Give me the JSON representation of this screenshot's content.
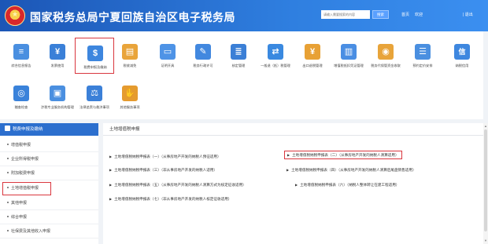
{
  "header": {
    "title": "国家税务总局宁夏回族自治区电子税务局",
    "search_placeholder": "请输入需要搜索的内容",
    "search_button": "搜索",
    "link_home": "首页",
    "link_welcome": "欢迎",
    "link_logout": "| 退出"
  },
  "top_menu": [
    {
      "label": "综合信息报告",
      "icon": "report-icon",
      "color": "#4a8fe0",
      "glyph": "≡"
    },
    {
      "label": "发票使用",
      "icon": "invoice-icon",
      "color": "#3a80d8",
      "glyph": "¥"
    },
    {
      "label": "税费申报及缴纳",
      "icon": "tax-declare-icon",
      "color": "#3d86de",
      "glyph": "$"
    },
    {
      "label": "税收减免",
      "icon": "tax-reduction-icon",
      "color": "#e9a43a",
      "glyph": "▤"
    },
    {
      "label": "证明开具",
      "icon": "certificate-icon",
      "color": "#4e93e6",
      "glyph": "▭"
    },
    {
      "label": "税务行政许可",
      "icon": "permit-icon",
      "color": "#4288df",
      "glyph": "✎"
    },
    {
      "label": "核定管理",
      "icon": "verify-icon",
      "color": "#3b7fd6",
      "glyph": "≣"
    },
    {
      "label": "一般退（抵）税管理",
      "icon": "refund-icon",
      "color": "#3a89e0",
      "glyph": "⇄"
    },
    {
      "label": "出口退税管理",
      "icon": "export-refund-icon",
      "color": "#e8a135",
      "glyph": "¥"
    },
    {
      "label": "增值税抵扣凭证管理",
      "icon": "vat-voucher-icon",
      "color": "#4a8ee3",
      "glyph": "▥"
    },
    {
      "label": "税务代保管资金收取",
      "icon": "custody-fund-icon",
      "color": "#e8a43a",
      "glyph": "◉"
    },
    {
      "label": "预约定价安排",
      "icon": "pricing-icon",
      "color": "#4a8fe0",
      "glyph": "☰"
    },
    {
      "label": "纳税信用",
      "icon": "credit-icon",
      "color": "#3e87df",
      "glyph": "信"
    },
    {
      "label": "稽查检查",
      "icon": "inspection-icon",
      "color": "#3a82da",
      "glyph": "◎"
    },
    {
      "label": "涉税专业服务机构管理",
      "icon": "agency-icon",
      "color": "#4a8fe0",
      "glyph": "▣"
    },
    {
      "label": "法律追责与救济事项",
      "icon": "legal-icon",
      "color": "#3b80d8",
      "glyph": "⚖"
    },
    {
      "label": "其他服务事项",
      "icon": "other-service-icon",
      "color": "#e59b2f",
      "glyph": "✋"
    }
  ],
  "sidebar": {
    "title": "税费申报及缴纳",
    "items": [
      {
        "label": "增值税申报"
      },
      {
        "label": "企业所得税申报"
      },
      {
        "label": "附加税费申报"
      },
      {
        "label": "土地增值税申报"
      },
      {
        "label": "其他申报"
      },
      {
        "label": "综合申报"
      },
      {
        "label": "社保费及其他收入申报"
      }
    ]
  },
  "main": {
    "tab": "土地增值税申报",
    "forms": [
      "土地增值税纳税申报表（一）（从事房地产开发的纳税人预征适用）",
      "土地增值税纳税申报表（二）（从事房地产开发的纳税人清算适用）",
      "土地增值税纳税申报表（三）（非从事房地产开发的纳税人适用）",
      "土地增值税纳税申报表（四）（从事房地产开发的纳税人清算后尾盘销售适用）",
      "土地增值税纳税申报表（五）（从事房地产开发的纳税人清算方式为核定征收适用）",
      "土地增值税纳税申报表（六）（纳税人整体转让在建工程适用）",
      "土地增值税纳税申报表（七）（非从事房地产开发的纳税人核定征收适用）"
    ]
  },
  "colors": {
    "header": "#1c56b6",
    "accent": "#2c6fce",
    "highlight": "#d9363e"
  }
}
